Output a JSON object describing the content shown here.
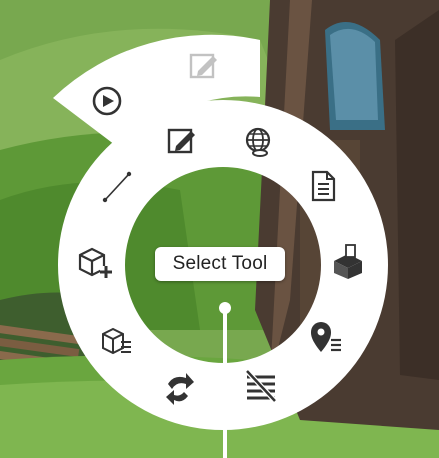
{
  "tooltip": {
    "label": "Select Tool"
  },
  "submenu": {
    "items": [
      {
        "icon": "play-circle-icon",
        "state": "active"
      },
      {
        "icon": "edit-note-icon",
        "state": "disabled"
      }
    ]
  },
  "ring": {
    "items": [
      {
        "icon": "edit-note-icon",
        "position": "top-left"
      },
      {
        "icon": "globe-link-icon",
        "position": "top-right"
      },
      {
        "icon": "document-icon",
        "position": "right-upper"
      },
      {
        "icon": "box-import-icon",
        "position": "right"
      },
      {
        "icon": "location-list-icon",
        "position": "right-lower"
      },
      {
        "icon": "strikethrough-lines-icon",
        "position": "bottom-right"
      },
      {
        "icon": "undo-redo-icon",
        "position": "bottom-left"
      },
      {
        "icon": "cube-list-icon",
        "position": "left-lower"
      },
      {
        "icon": "cube-add-icon",
        "position": "left"
      },
      {
        "icon": "line-tool-icon",
        "position": "left-upper"
      }
    ]
  },
  "colors": {
    "menu_bg": "#ffffff",
    "icon": "#333333",
    "icon_disabled": "#bdbdbd",
    "grass": "#5f9a3a",
    "hill": "#7dab55",
    "building": "#4a3b31"
  }
}
